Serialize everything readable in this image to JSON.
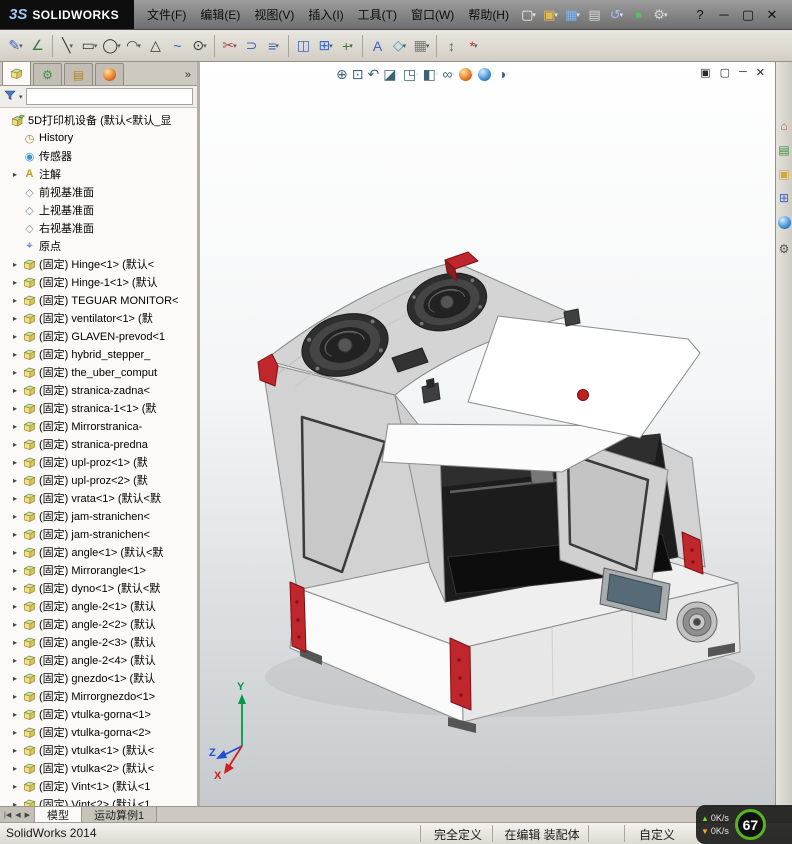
{
  "titlebar": {
    "logo_mark": "3S",
    "logo": "SOLIDWORKS",
    "menus": [
      "文件(F)",
      "编辑(E)",
      "视图(V)",
      "插入(I)",
      "工具(T)",
      "窗口(W)",
      "帮助(H)"
    ],
    "quick_icons": [
      {
        "name": "new-file-icon",
        "dropdown": true
      },
      {
        "name": "open-file-icon",
        "dropdown": true
      },
      {
        "name": "save-icon",
        "dropdown": true
      },
      {
        "name": "print-icon"
      },
      {
        "name": "undo-icon",
        "dropdown": true
      },
      {
        "name": "rebuild-icon"
      },
      {
        "name": "options-icon",
        "dropdown": true
      }
    ],
    "window_controls": [
      "help-icon",
      "minimize-icon",
      "maximize-icon",
      "close-icon"
    ]
  },
  "toolbar": {
    "items": [
      {
        "name": "sketch-icon",
        "dropdown": true
      },
      {
        "name": "smart-dimension-icon"
      },
      {
        "sep": true
      },
      {
        "name": "line-icon",
        "dropdown": true
      },
      {
        "name": "rectangle-icon",
        "dropdown": true
      },
      {
        "name": "circle-icon",
        "dropdown": true
      },
      {
        "name": "arc-icon",
        "dropdown": true
      },
      {
        "name": "polygon-icon"
      },
      {
        "name": "spline-icon"
      },
      {
        "name": "ellipse-icon",
        "dropdown": true
      },
      {
        "sep": true
      },
      {
        "name": "trim-entities-icon",
        "dropdown": true
      },
      {
        "name": "convert-entities-icon"
      },
      {
        "name": "offset-entities-icon",
        "dropdown": true
      },
      {
        "sep": true
      },
      {
        "name": "mirror-entities-icon"
      },
      {
        "name": "linear-pattern-icon",
        "dropdown": true
      },
      {
        "name": "move-entities-icon",
        "dropdown": true
      },
      {
        "sep": true
      },
      {
        "name": "text-icon"
      },
      {
        "name": "plane-icon",
        "dropdown": true
      },
      {
        "name": "quick-snaps-icon",
        "dropdown": true
      },
      {
        "sep": true
      },
      {
        "name": "instant2d-icon"
      },
      {
        "name": "reference-geometry-icon",
        "dropdown": true
      }
    ]
  },
  "feature_panel": {
    "tabs": [
      "featuremanager-tab",
      "propertymanager-tab",
      "configurationmanager-tab",
      "displaymanager-tab"
    ],
    "overflow_label": "»",
    "filter_placeholder": "",
    "root": {
      "icon": "assembly",
      "label": "5D打印机设备 (默认<默认_显"
    },
    "items": [
      {
        "icon": "history",
        "label": "History"
      },
      {
        "icon": "sensor",
        "label": "传感器"
      },
      {
        "icon": "annotation",
        "label": "注解",
        "arrow": true
      },
      {
        "icon": "plane",
        "label": "前视基准面"
      },
      {
        "icon": "plane",
        "label": "上视基准面"
      },
      {
        "icon": "plane",
        "label": "右视基准面"
      },
      {
        "icon": "origin",
        "label": "原点"
      },
      {
        "icon": "part",
        "label": "(固定) Hinge<1> (默认<",
        "arrow": true
      },
      {
        "icon": "part",
        "label": "(固定) Hinge-1<1> (默认",
        "arrow": true
      },
      {
        "icon": "part",
        "label": "(固定) TEGUAR MONITOR<",
        "arrow": true
      },
      {
        "icon": "part",
        "label": "(固定) ventilator<1> (默",
        "arrow": true
      },
      {
        "icon": "part",
        "label": "(固定) GLAVEN-prevod<1",
        "arrow": true
      },
      {
        "icon": "part",
        "label": "(固定) hybrid_stepper_",
        "arrow": true
      },
      {
        "icon": "part",
        "label": "(固定) the_uber_comput",
        "arrow": true
      },
      {
        "icon": "part",
        "label": "(固定) stranica-zadna<",
        "arrow": true
      },
      {
        "icon": "part",
        "label": "(固定) stranica-1<1> (默",
        "arrow": true
      },
      {
        "icon": "part",
        "label": "(固定) Mirrorstranica-",
        "arrow": true
      },
      {
        "icon": "part",
        "label": "(固定) stranica-predna",
        "arrow": true
      },
      {
        "icon": "part",
        "label": "(固定) upl-proz<1> (默",
        "arrow": true
      },
      {
        "icon": "part",
        "label": "(固定) upl-proz<2> (默",
        "arrow": true
      },
      {
        "icon": "part",
        "label": "(固定) vrata<1> (默认<默",
        "arrow": true
      },
      {
        "icon": "part",
        "label": "(固定) jam-stranichen<",
        "arrow": true
      },
      {
        "icon": "part",
        "label": "(固定) jam-stranichen<",
        "arrow": true
      },
      {
        "icon": "part",
        "label": "(固定) angle<1> (默认<默",
        "arrow": true
      },
      {
        "icon": "part",
        "label": "(固定) Mirrorangle<1>",
        "arrow": true
      },
      {
        "icon": "part",
        "label": "(固定) dyno<1> (默认<默",
        "arrow": true
      },
      {
        "icon": "part",
        "label": "(固定) angle-2<1> (默认",
        "arrow": true
      },
      {
        "icon": "part",
        "label": "(固定) angle-2<2> (默认",
        "arrow": true
      },
      {
        "icon": "part",
        "label": "(固定) angle-2<3> (默认",
        "arrow": true
      },
      {
        "icon": "part",
        "label": "(固定) angle-2<4> (默认",
        "arrow": true
      },
      {
        "icon": "part",
        "label": "(固定) gnezdo<1> (默认",
        "arrow": true
      },
      {
        "icon": "part",
        "label": "(固定) Mirrorgnezdo<1>",
        "arrow": true
      },
      {
        "icon": "part",
        "label": "(固定) vtulka-gorna<1>",
        "arrow": true
      },
      {
        "icon": "part",
        "label": "(固定) vtulka-gorna<2>",
        "arrow": true
      },
      {
        "icon": "part",
        "label": "(固定) vtulka<1> (默认<",
        "arrow": true
      },
      {
        "icon": "part",
        "label": "(固定) vtulka<2> (默认<",
        "arrow": true
      },
      {
        "icon": "part",
        "label": "(固定) Vint<1> (默认<1",
        "arrow": true
      },
      {
        "icon": "part",
        "label": "(固定) Vint<2> (默认<1",
        "arrow": true
      }
    ]
  },
  "viewport": {
    "hud_icons": [
      {
        "name": "zoom-fit-icon"
      },
      {
        "name": "zoom-area-icon"
      },
      {
        "name": "previous-view-icon"
      },
      {
        "name": "section-view-icon",
        "dropdown": true
      },
      {
        "name": "view-orientation-icon",
        "dropdown": true
      },
      {
        "name": "display-style-icon",
        "dropdown": true
      },
      {
        "name": "hide-show-items-icon",
        "dropdown": true
      },
      {
        "name": "edit-appearance-icon",
        "dropdown": true
      },
      {
        "name": "apply-scene-icon",
        "dropdown": true
      },
      {
        "name": "view-settings-icon",
        "dropdown": true
      }
    ],
    "doc_controls": [
      "cascade-icon",
      "tile-icon",
      "minimize-doc-icon",
      "close-doc-icon"
    ],
    "triad": {
      "x": "X",
      "y": "Y",
      "z": "Z"
    }
  },
  "taskpane": {
    "icons": [
      "home-icon",
      "design-library-icon",
      "file-explorer-icon",
      "view-palette-icon",
      "appearances-icon",
      "custom-properties-icon"
    ]
  },
  "bottom_tabs": {
    "nav": [
      "first-sheet-icon",
      "prev-sheet-icon",
      "next-sheet-icon"
    ],
    "tabs": [
      {
        "label": "模型",
        "active": true
      },
      {
        "label": "运动算例1",
        "active": false
      }
    ]
  },
  "statusbar": {
    "app": "SolidWorks 2014",
    "segments": [
      "完全定义",
      "在编辑 装配体",
      "自定义"
    ]
  },
  "overlay": {
    "up_speed": "0K/s",
    "down_speed": "0K/s",
    "score": "67"
  },
  "colors": {
    "accent_red": "#c0272d",
    "fan_dark": "#2e2e2e",
    "net_green": "#55b41f",
    "net_orange": "#f5a623"
  }
}
